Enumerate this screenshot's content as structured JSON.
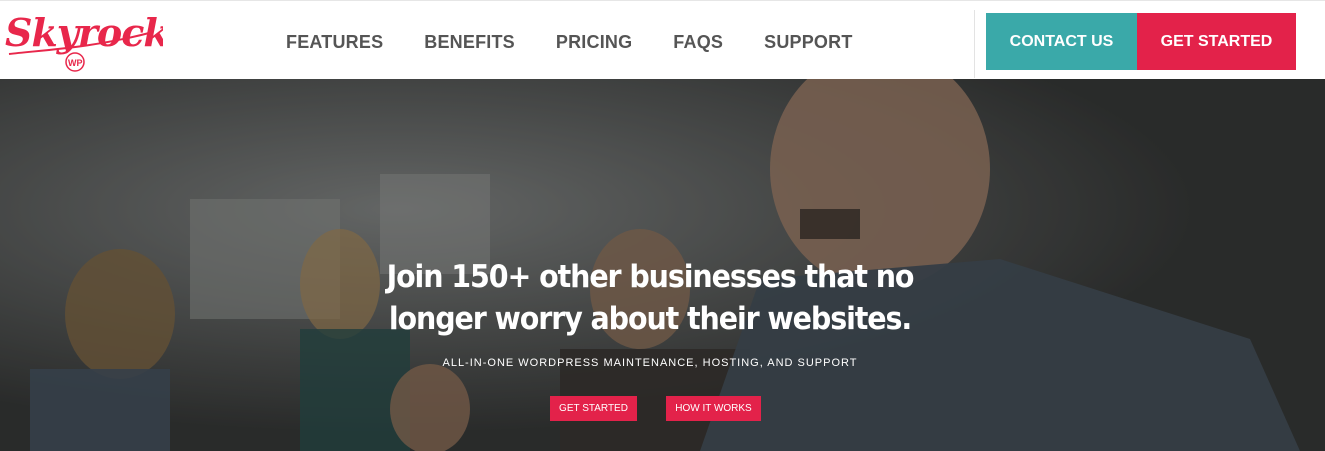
{
  "brand": {
    "name": "Skyrocket",
    "badge": "WP",
    "color": "#e8274b"
  },
  "nav": {
    "items": [
      {
        "label": "FEATURES"
      },
      {
        "label": "BENEFITS"
      },
      {
        "label": "PRICING"
      },
      {
        "label": "FAQS"
      },
      {
        "label": "SUPPORT"
      }
    ]
  },
  "header_actions": {
    "contact_label": "CONTACT US",
    "contact_color": "#3aa9a9",
    "get_started_label": "GET STARTED",
    "get_started_color": "#e3224a"
  },
  "hero": {
    "headline_line1": "Join 150+ other businesses that no",
    "headline_line2": "longer worry about their websites.",
    "subheadline": "ALL-IN-ONE WORDPRESS MAINTENANCE, HOSTING, AND SUPPORT",
    "primary_button": "GET STARTED",
    "secondary_button": "HOW IT WORKS"
  }
}
